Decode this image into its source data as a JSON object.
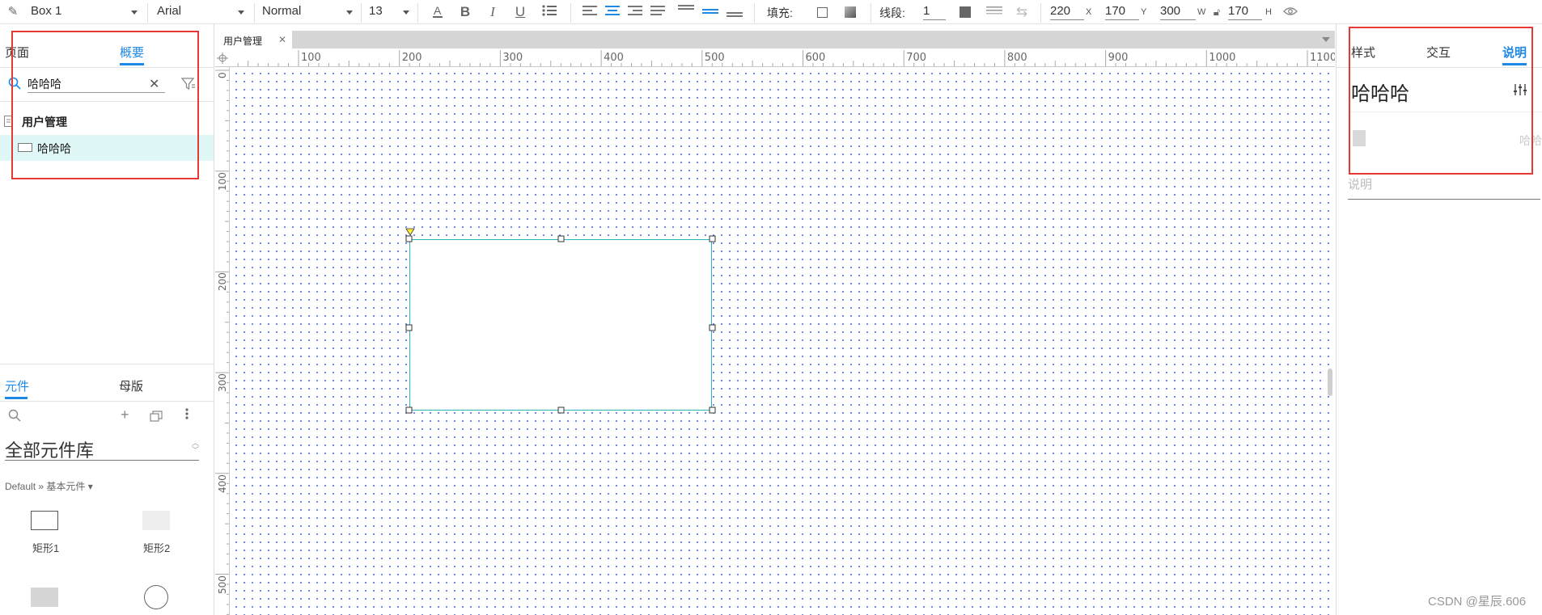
{
  "toolbar": {
    "shape_select": "Box 1",
    "font_family": "Arial",
    "font_weight": "Normal",
    "font_size": "13",
    "fill_label": "填充:",
    "stroke_label": "线段:",
    "stroke_value": "1",
    "x_value": "220",
    "x_unit": "X",
    "y_value": "170",
    "y_unit": "Y",
    "w_value": "300",
    "w_unit": "W",
    "h_value": "170",
    "h_unit": "H"
  },
  "left_panel": {
    "tabs": [
      "页面",
      "概要"
    ],
    "active_tab": "概要",
    "search_value": "哈哈哈",
    "outline": {
      "page_name": "用户管理",
      "items": [
        "哈哈哈"
      ]
    },
    "library_tabs": [
      "元件",
      "母版"
    ],
    "library_active": "元件",
    "library_select": "全部元件库",
    "library_path": "Default » 基本元件 ▾",
    "widgets": [
      "矩形1",
      "矩形2"
    ]
  },
  "canvas": {
    "doc_tab": "用户管理",
    "ruler_top": [
      "100",
      "200",
      "300",
      "400",
      "500",
      "600",
      "700",
      "800",
      "900",
      "1000",
      "1100"
    ],
    "ruler_left": [
      "0",
      "100",
      "200",
      "300",
      "400",
      "500"
    ]
  },
  "right_panel": {
    "tabs": [
      "样式",
      "交互",
      "说明"
    ],
    "active_tab": "说明",
    "widget_name": "哈哈哈",
    "note_value": "哈哈",
    "note_placeholder": "说明"
  },
  "watermark": "CSDN @星辰.606",
  "colors": {
    "accent": "#1e88e5",
    "selection": "#26b7bc",
    "highlight_box": "#e53935",
    "grid_dot": "#4a6cf5",
    "row_selected": "#e0f7f7"
  }
}
